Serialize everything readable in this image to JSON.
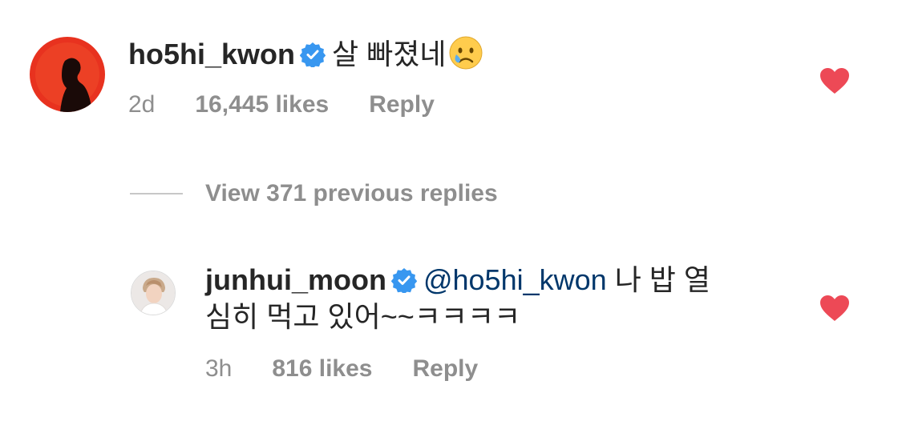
{
  "comment": {
    "username": "ho5hi_kwon",
    "text": "살 빠졌네",
    "emoji": "crying-face-emoji",
    "time": "2d",
    "likes": "16,445 likes",
    "reply_label": "Reply",
    "liked": true
  },
  "view_replies": "View 371 previous replies",
  "reply": {
    "username": "junhui_moon",
    "mention": "@ho5hi_kwon",
    "text_line1": "나 밥 열",
    "text_line2": "심히 먹고 있어~~ㅋㅋㅋㅋ",
    "time": "3h",
    "likes": "816 likes",
    "reply_label": "Reply",
    "liked": true
  },
  "colors": {
    "heart": "#ed4956",
    "verified": "#3897f0",
    "mention": "#00376b",
    "muted": "#8e8e8e"
  }
}
